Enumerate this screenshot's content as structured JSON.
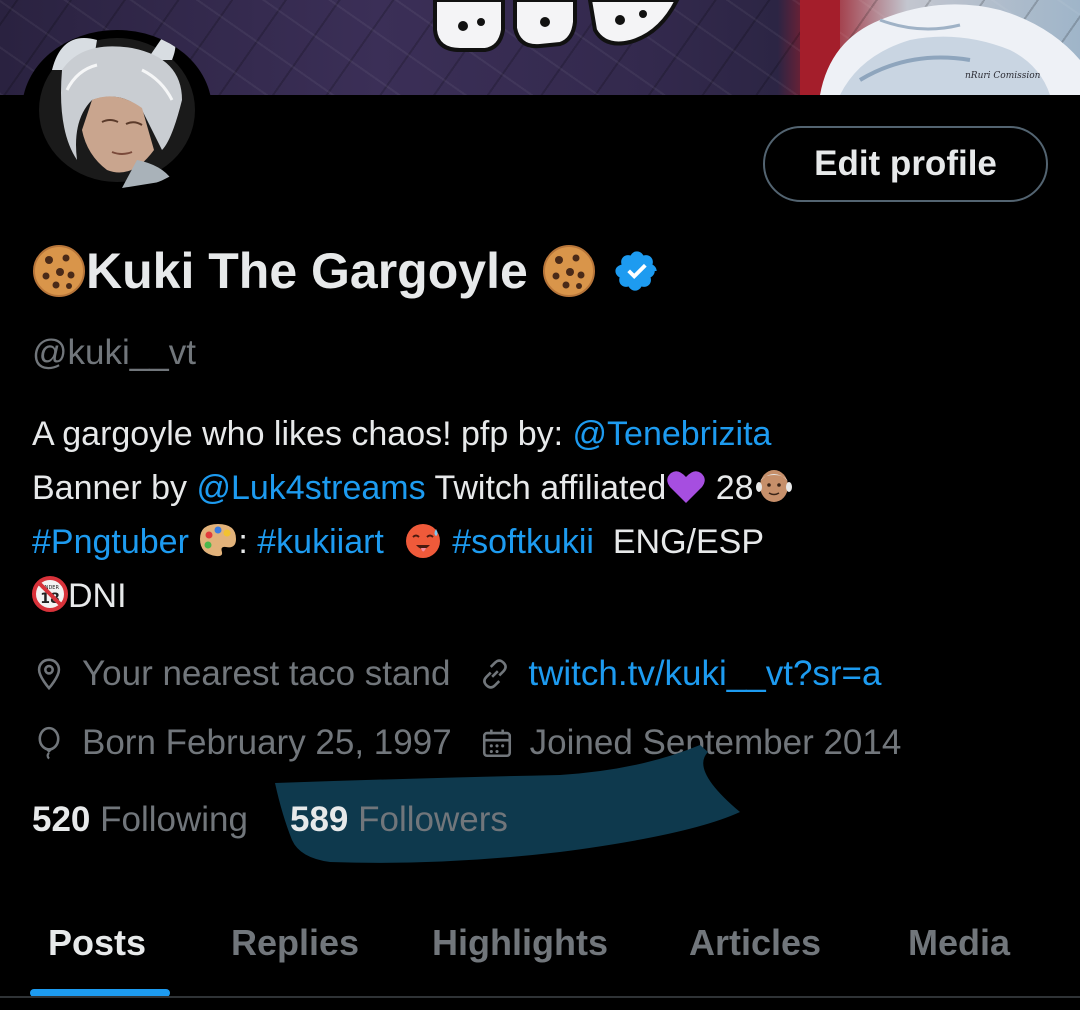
{
  "banner": {
    "artist_sign": "nRuri Comission"
  },
  "profile": {
    "edit_button_label": "Edit profile",
    "display_name": "Kuki The Gargoyle",
    "display_name_emoji": "cookie-icon",
    "verified": true,
    "handle": "@kuki__vt"
  },
  "bio": {
    "line1_text": "A gargoyle who likes chaos! pfp by: ",
    "line1_link": "@Tenebrizita",
    "line2_text": "Banner by ",
    "line2_link": "@Luk4streams",
    "line2_after": " Twitch affiliated",
    "line2_age": " 28",
    "line3_tag1": "#Pngtuber",
    "line3_sep": ": ",
    "line3_tag2": "#kukiiart",
    "line3_tag3": "#softkukii",
    "line3_lang": "  ENG/ESP",
    "line4_text": "DNI"
  },
  "meta": {
    "location": "Your nearest taco stand",
    "website": "twitch.tv/kuki__vt?sr=a",
    "birthday": "Born February 25, 1997",
    "joined": "Joined September 2014"
  },
  "stats": {
    "following_count": "520",
    "following_label": "Following",
    "followers_count": "589",
    "followers_label": "Followers"
  },
  "tabs": [
    {
      "label": "Posts",
      "active": true
    },
    {
      "label": "Replies",
      "active": false
    },
    {
      "label": "Highlights",
      "active": false
    },
    {
      "label": "Articles",
      "active": false
    },
    {
      "label": "Media",
      "active": false
    }
  ],
  "colors": {
    "accent": "#1d9bf0",
    "text_primary": "#e7e9ea",
    "text_secondary": "#71767b",
    "background": "#000000",
    "redaction_scribble": "#0f3a4f"
  }
}
